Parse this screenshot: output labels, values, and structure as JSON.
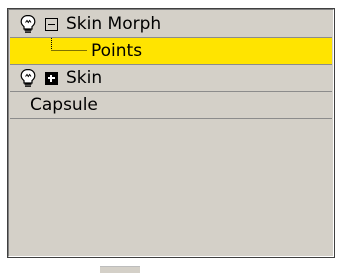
{
  "modifier_stack": {
    "items": [
      {
        "label": "Skin Morph",
        "expander": "minus",
        "icon": "lightbulb-icon",
        "selected": false
      },
      {
        "label": "Points",
        "expander": null,
        "icon": null,
        "selected": true
      },
      {
        "label": "Skin",
        "expander": "plus",
        "icon": "lightbulb-icon",
        "selected": false
      },
      {
        "label": "Capsule",
        "expander": null,
        "icon": null,
        "selected": false
      }
    ]
  },
  "colors": {
    "panel_bg": "#d4d0c8",
    "selection": "#ffe400",
    "row_divider": "#8c8c8c"
  }
}
